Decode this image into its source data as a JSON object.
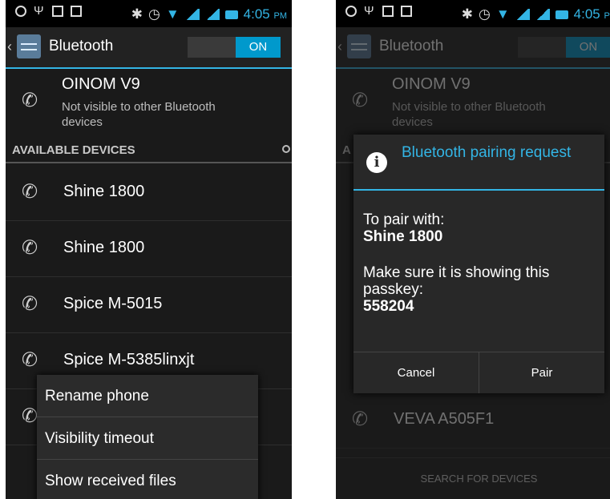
{
  "status": {
    "time": "4:05",
    "ampm": "PM"
  },
  "left": {
    "title": "Bluetooth",
    "toggle": "ON",
    "paired": {
      "name": "OINOM V9",
      "status": "Not visible to other Bluetooth devices"
    },
    "section": "AVAILABLE DEVICES",
    "devices": [
      "Shine 1800",
      "Shine 1800",
      "Spice M-5015",
      "Spice M-5385linxjt"
    ],
    "menu": [
      "Rename phone",
      "Visibility timeout",
      "Show received files"
    ]
  },
  "right": {
    "title": "Bluetooth",
    "toggle": "ON",
    "paired": {
      "name": "OINOM V9",
      "status": "Not visible to other Bluetooth devices"
    },
    "section": "A",
    "dialog": {
      "title": "Bluetooth pairing request",
      "line1": "To pair with:",
      "device": "Shine 1800",
      "line2": "Make sure it is showing this passkey:",
      "passkey": "558204",
      "cancel": "Cancel",
      "pair": "Pair"
    },
    "bottom_device": "VEVA A505F1",
    "search": "SEARCH FOR DEVICES"
  },
  "colors": {
    "accent": "#33b5e5",
    "toggle_on": "#0099cc",
    "background": "#1a1a1a"
  }
}
